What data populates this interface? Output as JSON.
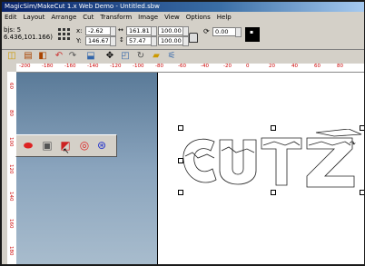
{
  "window": {
    "title": "MagicSim/MakeCut 1.x Web Demo - Untitled.sbw"
  },
  "menu": [
    "Edit",
    "Layout",
    "Arrange",
    "Cut",
    "Transform",
    "Image",
    "View",
    "Options",
    "Help"
  ],
  "props": {
    "objs_label": "bjs: 5",
    "objs_coords": "6.436,101.166)",
    "x_label": "x:",
    "x_value": "-2.62",
    "y_label": "Y:",
    "y_value": "146.67",
    "w_value": "161.81",
    "h_value": "57.47",
    "sw_value": "100.00",
    "sh_value": "100.00",
    "angle_value": "0.00"
  },
  "ruler_h": [
    "-200",
    "-180",
    "-160",
    "-140",
    "-120",
    "-100",
    "-80",
    "-60",
    "-40",
    "-20",
    "0",
    "20",
    "40",
    "60",
    "80"
  ],
  "ruler_v": [
    "60",
    "80",
    "100",
    "120",
    "140",
    "160",
    "180"
  ],
  "icons": {
    "toolbar": [
      "open-icon",
      "print-icon",
      "save-icon",
      "undo-icon",
      "redo-icon",
      "cut-tool-icon",
      "move-icon",
      "import-icon",
      "rotate-icon",
      "folder-icon",
      "weld-icon"
    ],
    "floating": [
      "shape-icon",
      "text-icon",
      "image-icon",
      "pattern-icon",
      "tile-icon"
    ]
  },
  "colors": {
    "accent": "#c00000",
    "canvas": "#ffffff",
    "panel": "#6f8ba7"
  }
}
